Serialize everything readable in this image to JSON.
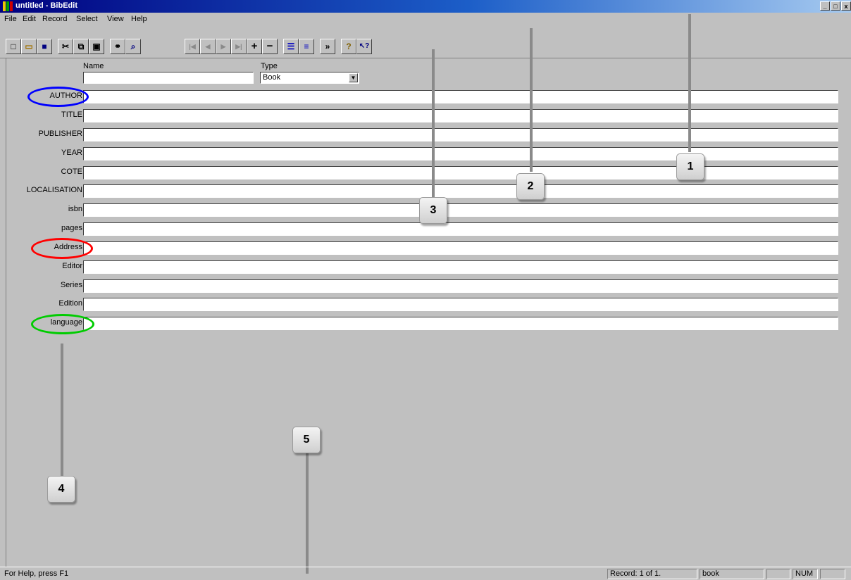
{
  "window": {
    "title": "untitled - BibEdit",
    "controls": {
      "minimize": "_",
      "maximize": "□",
      "close": "x"
    }
  },
  "menu": [
    "File",
    "Edit",
    "Record",
    "Select",
    "View",
    "Help"
  ],
  "toolbar": {
    "buttons": [
      {
        "name": "new",
        "icon": "new-document-icon",
        "glyph": "□"
      },
      {
        "name": "open",
        "icon": "open-folder-icon",
        "glyph": "▭"
      },
      {
        "name": "save",
        "icon": "save-disk-icon",
        "glyph": "■"
      },
      {
        "name": "cut",
        "icon": "scissors-icon",
        "glyph": "✂"
      },
      {
        "name": "copy",
        "icon": "copy-icon",
        "glyph": "⧉"
      },
      {
        "name": "paste",
        "icon": "paste-icon",
        "glyph": "▣"
      },
      {
        "name": "find",
        "icon": "binoculars-icon",
        "glyph": "⚭"
      },
      {
        "name": "zoom",
        "icon": "magnifier-icon",
        "glyph": "⌕"
      },
      {
        "name": "first-record",
        "icon": "first-record-icon",
        "glyph": "|◀"
      },
      {
        "name": "previous-record",
        "icon": "previous-record-icon",
        "glyph": "◀"
      },
      {
        "name": "next-record",
        "icon": "next-record-icon",
        "glyph": "▶"
      },
      {
        "name": "last-record",
        "icon": "last-record-icon",
        "glyph": "▶|"
      },
      {
        "name": "add-record",
        "icon": "plus-icon",
        "glyph": "+"
      },
      {
        "name": "delete-record",
        "icon": "minus-icon",
        "glyph": "−"
      },
      {
        "name": "list-view",
        "icon": "list-view-icon",
        "glyph": "☰"
      },
      {
        "name": "details-view",
        "icon": "details-view-icon",
        "glyph": "≡"
      },
      {
        "name": "filter",
        "icon": "filter-icon",
        "glyph": "»"
      },
      {
        "name": "help",
        "icon": "help-icon",
        "glyph": "?"
      },
      {
        "name": "context-help",
        "icon": "context-help-icon",
        "glyph": "↖?"
      }
    ]
  },
  "header": {
    "name_label": "Name",
    "name_value": "",
    "type_label": "Type",
    "type_value": "Book"
  },
  "fields": [
    {
      "label": "AUTHOR",
      "value": ""
    },
    {
      "label": "TITLE",
      "value": ""
    },
    {
      "label": "PUBLISHER",
      "value": ""
    },
    {
      "label": "YEAR",
      "value": ""
    },
    {
      "label": "COTE",
      "value": ""
    },
    {
      "label": "LOCALISATION",
      "value": ""
    },
    {
      "label": "isbn",
      "value": ""
    },
    {
      "label": "pages",
      "value": ""
    },
    {
      "label": "Address",
      "value": ""
    },
    {
      "label": "Editor",
      "value": ""
    },
    {
      "label": "Series",
      "value": ""
    },
    {
      "label": "Edition",
      "value": ""
    },
    {
      "label": "language",
      "value": ""
    }
  ],
  "highlights": [
    {
      "field": "AUTHOR",
      "color": "#0000ff"
    },
    {
      "field": "Address",
      "color": "#ff0000"
    },
    {
      "field": "language",
      "color": "#00cc00"
    }
  ],
  "callouts": [
    "1",
    "2",
    "3",
    "4",
    "5"
  ],
  "status": {
    "help": "For Help, press F1",
    "record": "Record: 1 of 1.",
    "type": "book",
    "empty": "",
    "num": "NUM"
  }
}
